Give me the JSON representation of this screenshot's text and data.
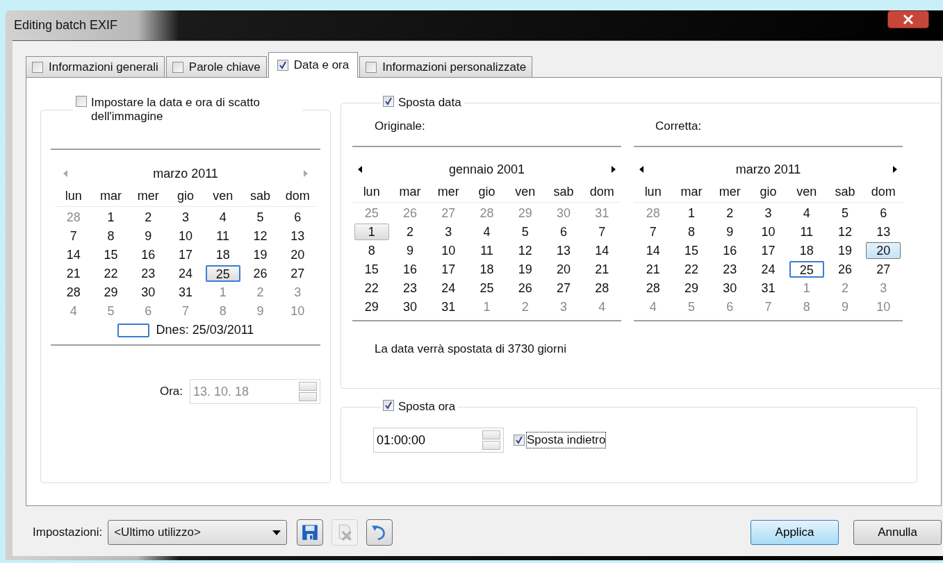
{
  "window": {
    "title": "Editing batch EXIF"
  },
  "tabs": [
    {
      "label": "Informazioni generali",
      "checked": false,
      "selected": false
    },
    {
      "label": "Parole chiave",
      "checked": false,
      "selected": false
    },
    {
      "label": "Data e ora",
      "checked": true,
      "selected": true
    },
    {
      "label": "Informazioni personalizzate",
      "checked": false,
      "selected": false
    }
  ],
  "capture_date": {
    "checked": false,
    "label": "Impostare la data e ora di scatto dell'immagine",
    "calendar": {
      "title": "marzo 2011",
      "nav_disabled": true,
      "focused": false,
      "today_label": "Dnes: 25/03/2011",
      "weekdays": [
        "lun",
        "mar",
        "mer",
        "gio",
        "ven",
        "sab",
        "dom"
      ],
      "weeks": [
        [
          {
            "day": "28",
            "other_month": true,
            "selected": false,
            "today": false
          },
          {
            "day": "1",
            "other_month": false,
            "selected": false,
            "today": false
          },
          {
            "day": "2",
            "other_month": false,
            "selected": false,
            "today": false
          },
          {
            "day": "3",
            "other_month": false,
            "selected": false,
            "today": false
          },
          {
            "day": "4",
            "other_month": false,
            "selected": false,
            "today": false
          },
          {
            "day": "5",
            "other_month": false,
            "selected": false,
            "today": false
          },
          {
            "day": "6",
            "other_month": false,
            "selected": false,
            "today": false
          }
        ],
        [
          {
            "day": "7",
            "other_month": false,
            "selected": false,
            "today": false
          },
          {
            "day": "8",
            "other_month": false,
            "selected": false,
            "today": false
          },
          {
            "day": "9",
            "other_month": false,
            "selected": false,
            "today": false
          },
          {
            "day": "10",
            "other_month": false,
            "selected": false,
            "today": false
          },
          {
            "day": "11",
            "other_month": false,
            "selected": false,
            "today": false
          },
          {
            "day": "12",
            "other_month": false,
            "selected": false,
            "today": false
          },
          {
            "day": "13",
            "other_month": false,
            "selected": false,
            "today": false
          }
        ],
        [
          {
            "day": "14",
            "other_month": false,
            "selected": false,
            "today": false
          },
          {
            "day": "15",
            "other_month": false,
            "selected": false,
            "today": false
          },
          {
            "day": "16",
            "other_month": false,
            "selected": false,
            "today": false
          },
          {
            "day": "17",
            "other_month": false,
            "selected": false,
            "today": false
          },
          {
            "day": "18",
            "other_month": false,
            "selected": false,
            "today": false
          },
          {
            "day": "19",
            "other_month": false,
            "selected": false,
            "today": false
          },
          {
            "day": "20",
            "other_month": false,
            "selected": false,
            "today": false
          }
        ],
        [
          {
            "day": "21",
            "other_month": false,
            "selected": false,
            "today": false
          },
          {
            "day": "22",
            "other_month": false,
            "selected": false,
            "today": false
          },
          {
            "day": "23",
            "other_month": false,
            "selected": false,
            "today": false
          },
          {
            "day": "24",
            "other_month": false,
            "selected": false,
            "today": false
          },
          {
            "day": "25",
            "other_month": false,
            "selected": true,
            "today": true
          },
          {
            "day": "26",
            "other_month": false,
            "selected": false,
            "today": false
          },
          {
            "day": "27",
            "other_month": false,
            "selected": false,
            "today": false
          }
        ],
        [
          {
            "day": "28",
            "other_month": false,
            "selected": false,
            "today": false
          },
          {
            "day": "29",
            "other_month": false,
            "selected": false,
            "today": false
          },
          {
            "day": "30",
            "other_month": false,
            "selected": false,
            "today": false
          },
          {
            "day": "31",
            "other_month": false,
            "selected": false,
            "today": false
          },
          {
            "day": "1",
            "other_month": true,
            "selected": false,
            "today": false
          },
          {
            "day": "2",
            "other_month": true,
            "selected": false,
            "today": false
          },
          {
            "day": "3",
            "other_month": true,
            "selected": false,
            "today": false
          }
        ],
        [
          {
            "day": "4",
            "other_month": true,
            "selected": false,
            "today": false
          },
          {
            "day": "5",
            "other_month": true,
            "selected": false,
            "today": false
          },
          {
            "day": "6",
            "other_month": true,
            "selected": false,
            "today": false
          },
          {
            "day": "7",
            "other_month": true,
            "selected": false,
            "today": false
          },
          {
            "day": "8",
            "other_month": true,
            "selected": false,
            "today": false
          },
          {
            "day": "9",
            "other_month": true,
            "selected": false,
            "today": false
          },
          {
            "day": "10",
            "other_month": true,
            "selected": false,
            "today": false
          }
        ]
      ]
    },
    "time_label": "Ora:",
    "time_value": "13. 10. 18",
    "time_disabled": true
  },
  "date_shift": {
    "checked": true,
    "label": "Sposta data",
    "original_label": "Originale:",
    "corrected_label": "Corretta:",
    "calendars": [
      {
        "title": "gennaio 2001",
        "nav_disabled": false,
        "focused": false,
        "weekdays": [
          "lun",
          "mar",
          "mer",
          "gio",
          "ven",
          "sab",
          "dom"
        ],
        "weeks": [
          [
            {
              "day": "25",
              "other_month": true,
              "selected": false,
              "today": false
            },
            {
              "day": "26",
              "other_month": true,
              "selected": false,
              "today": false
            },
            {
              "day": "27",
              "other_month": true,
              "selected": false,
              "today": false
            },
            {
              "day": "28",
              "other_month": true,
              "selected": false,
              "today": false
            },
            {
              "day": "29",
              "other_month": true,
              "selected": false,
              "today": false
            },
            {
              "day": "30",
              "other_month": true,
              "selected": false,
              "today": false
            },
            {
              "day": "31",
              "other_month": true,
              "selected": false,
              "today": false
            }
          ],
          [
            {
              "day": "1",
              "other_month": false,
              "selected": true,
              "today": false
            },
            {
              "day": "2",
              "other_month": false,
              "selected": false,
              "today": false
            },
            {
              "day": "3",
              "other_month": false,
              "selected": false,
              "today": false
            },
            {
              "day": "4",
              "other_month": false,
              "selected": false,
              "today": false
            },
            {
              "day": "5",
              "other_month": false,
              "selected": false,
              "today": false
            },
            {
              "day": "6",
              "other_month": false,
              "selected": false,
              "today": false
            },
            {
              "day": "7",
              "other_month": false,
              "selected": false,
              "today": false
            }
          ],
          [
            {
              "day": "8",
              "other_month": false,
              "selected": false,
              "today": false
            },
            {
              "day": "9",
              "other_month": false,
              "selected": false,
              "today": false
            },
            {
              "day": "10",
              "other_month": false,
              "selected": false,
              "today": false
            },
            {
              "day": "11",
              "other_month": false,
              "selected": false,
              "today": false
            },
            {
              "day": "12",
              "other_month": false,
              "selected": false,
              "today": false
            },
            {
              "day": "13",
              "other_month": false,
              "selected": false,
              "today": false
            },
            {
              "day": "14",
              "other_month": false,
              "selected": false,
              "today": false
            }
          ],
          [
            {
              "day": "15",
              "other_month": false,
              "selected": false,
              "today": false
            },
            {
              "day": "16",
              "other_month": false,
              "selected": false,
              "today": false
            },
            {
              "day": "17",
              "other_month": false,
              "selected": false,
              "today": false
            },
            {
              "day": "18",
              "other_month": false,
              "selected": false,
              "today": false
            },
            {
              "day": "19",
              "other_month": false,
              "selected": false,
              "today": false
            },
            {
              "day": "20",
              "other_month": false,
              "selected": false,
              "today": false
            },
            {
              "day": "21",
              "other_month": false,
              "selected": false,
              "today": false
            }
          ],
          [
            {
              "day": "22",
              "other_month": false,
              "selected": false,
              "today": false
            },
            {
              "day": "23",
              "other_month": false,
              "selected": false,
              "today": false
            },
            {
              "day": "24",
              "other_month": false,
              "selected": false,
              "today": false
            },
            {
              "day": "25",
              "other_month": false,
              "selected": false,
              "today": false
            },
            {
              "day": "26",
              "other_month": false,
              "selected": false,
              "today": false
            },
            {
              "day": "27",
              "other_month": false,
              "selected": false,
              "today": false
            },
            {
              "day": "28",
              "other_month": false,
              "selected": false,
              "today": false
            }
          ],
          [
            {
              "day": "29",
              "other_month": false,
              "selected": false,
              "today": false
            },
            {
              "day": "30",
              "other_month": false,
              "selected": false,
              "today": false
            },
            {
              "day": "31",
              "other_month": false,
              "selected": false,
              "today": false
            },
            {
              "day": "1",
              "other_month": true,
              "selected": false,
              "today": false
            },
            {
              "day": "2",
              "other_month": true,
              "selected": false,
              "today": false
            },
            {
              "day": "3",
              "other_month": true,
              "selected": false,
              "today": false
            },
            {
              "day": "4",
              "other_month": true,
              "selected": false,
              "today": false
            }
          ]
        ]
      },
      {
        "title": "marzo 2011",
        "nav_disabled": false,
        "focused": true,
        "weekdays": [
          "lun",
          "mar",
          "mer",
          "gio",
          "ven",
          "sab",
          "dom"
        ],
        "weeks": [
          [
            {
              "day": "28",
              "other_month": true,
              "selected": false,
              "today": false
            },
            {
              "day": "1",
              "other_month": false,
              "selected": false,
              "today": false
            },
            {
              "day": "2",
              "other_month": false,
              "selected": false,
              "today": false
            },
            {
              "day": "3",
              "other_month": false,
              "selected": false,
              "today": false
            },
            {
              "day": "4",
              "other_month": false,
              "selected": false,
              "today": false
            },
            {
              "day": "5",
              "other_month": false,
              "selected": false,
              "today": false
            },
            {
              "day": "6",
              "other_month": false,
              "selected": false,
              "today": false
            }
          ],
          [
            {
              "day": "7",
              "other_month": false,
              "selected": false,
              "today": false
            },
            {
              "day": "8",
              "other_month": false,
              "selected": false,
              "today": false
            },
            {
              "day": "9",
              "other_month": false,
              "selected": false,
              "today": false
            },
            {
              "day": "10",
              "other_month": false,
              "selected": false,
              "today": false
            },
            {
              "day": "11",
              "other_month": false,
              "selected": false,
              "today": false
            },
            {
              "day": "12",
              "other_month": false,
              "selected": false,
              "today": false
            },
            {
              "day": "13",
              "other_month": false,
              "selected": false,
              "today": false
            }
          ],
          [
            {
              "day": "14",
              "other_month": false,
              "selected": false,
              "today": false
            },
            {
              "day": "15",
              "other_month": false,
              "selected": false,
              "today": false
            },
            {
              "day": "16",
              "other_month": false,
              "selected": false,
              "today": false
            },
            {
              "day": "17",
              "other_month": false,
              "selected": false,
              "today": false
            },
            {
              "day": "18",
              "other_month": false,
              "selected": false,
              "today": false
            },
            {
              "day": "19",
              "other_month": false,
              "selected": false,
              "today": false
            },
            {
              "day": "20",
              "other_month": false,
              "selected": true,
              "today": false
            }
          ],
          [
            {
              "day": "21",
              "other_month": false,
              "selected": false,
              "today": false
            },
            {
              "day": "22",
              "other_month": false,
              "selected": false,
              "today": false
            },
            {
              "day": "23",
              "other_month": false,
              "selected": false,
              "today": false
            },
            {
              "day": "24",
              "other_month": false,
              "selected": false,
              "today": false
            },
            {
              "day": "25",
              "other_month": false,
              "selected": false,
              "today": true
            },
            {
              "day": "26",
              "other_month": false,
              "selected": false,
              "today": false
            },
            {
              "day": "27",
              "other_month": false,
              "selected": false,
              "today": false
            }
          ],
          [
            {
              "day": "28",
              "other_month": false,
              "selected": false,
              "today": false
            },
            {
              "day": "29",
              "other_month": false,
              "selected": false,
              "today": false
            },
            {
              "day": "30",
              "other_month": false,
              "selected": false,
              "today": false
            },
            {
              "day": "31",
              "other_month": false,
              "selected": false,
              "today": false
            },
            {
              "day": "1",
              "other_month": true,
              "selected": false,
              "today": false
            },
            {
              "day": "2",
              "other_month": true,
              "selected": false,
              "today": false
            },
            {
              "day": "3",
              "other_month": true,
              "selected": false,
              "today": false
            }
          ],
          [
            {
              "day": "4",
              "other_month": true,
              "selected": false,
              "today": false
            },
            {
              "day": "5",
              "other_month": true,
              "selected": false,
              "today": false
            },
            {
              "day": "6",
              "other_month": true,
              "selected": false,
              "today": false
            },
            {
              "day": "7",
              "other_month": true,
              "selected": false,
              "today": false
            },
            {
              "day": "8",
              "other_month": true,
              "selected": false,
              "today": false
            },
            {
              "day": "9",
              "other_month": true,
              "selected": false,
              "today": false
            },
            {
              "day": "10",
              "other_month": true,
              "selected": false,
              "today": false
            }
          ]
        ]
      }
    ],
    "message": "La data verrà spostata di 3730 giorni"
  },
  "time_shift": {
    "checked": true,
    "label": "Sposta ora",
    "value": "01:00:00",
    "backward": {
      "checked": true,
      "label": "Sposta indietro"
    }
  },
  "footer": {
    "settings_label": "Impostazioni:",
    "preset": "<Ultimo utilizzo>",
    "tools": [
      {
        "kind": "save",
        "disabled": false
      },
      {
        "kind": "delete",
        "disabled": true
      },
      {
        "kind": "undo",
        "disabled": false
      }
    ],
    "buttons": [
      {
        "label": "Applica",
        "default": true
      },
      {
        "label": "Annulla",
        "default": false
      }
    ]
  }
}
